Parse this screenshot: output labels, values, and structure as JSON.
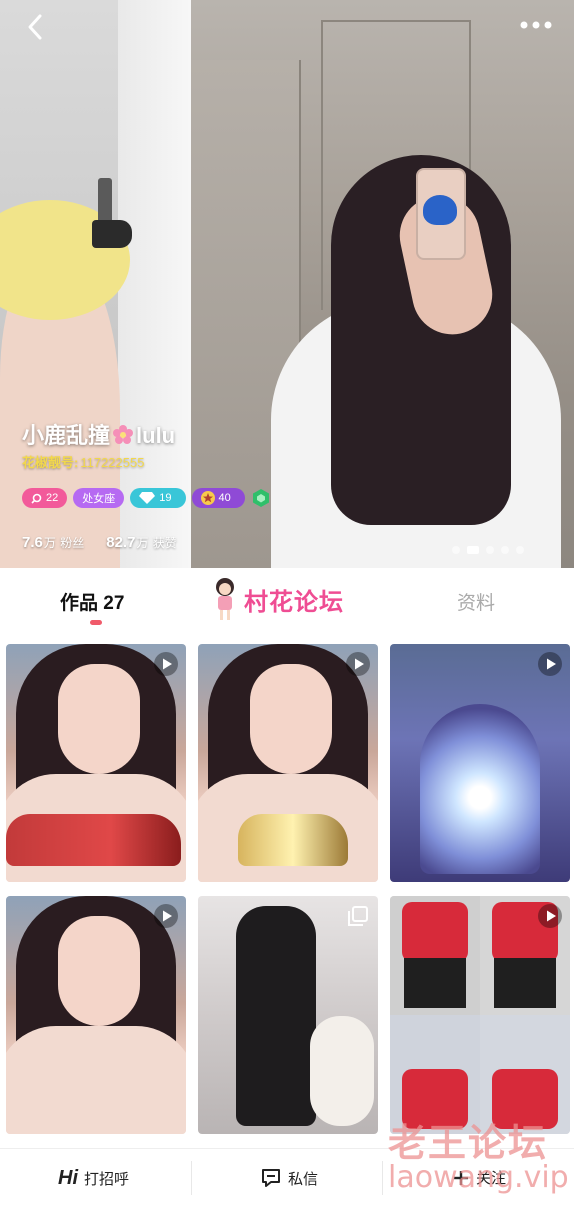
{
  "profile": {
    "name_prefix": "小鹿乱撞",
    "name_suffix": "lulu",
    "handle_label": "花椒靓号:",
    "handle_number": "117222555",
    "badges": {
      "level": "22",
      "tag": "处女座",
      "diamond": "19",
      "star": "40"
    },
    "fans_value": "7.6",
    "fans_unit": "万",
    "fans_label": "粉丝",
    "likes_value": "82.7",
    "likes_unit": "万",
    "likes_label": "获赞",
    "photo_index": 2,
    "photo_count": 5
  },
  "tabs": {
    "works_label": "作品",
    "works_count": "27",
    "info_label": "资料"
  },
  "overlay_watermarks": {
    "forum_center": "村花论坛",
    "corner_cn": "老王论坛",
    "corner_en": "laowang.vip"
  },
  "grid": {
    "tiles": [
      {
        "kind": "video",
        "theme": "face-red-car"
      },
      {
        "kind": "video",
        "theme": "face-gold-car"
      },
      {
        "kind": "video",
        "theme": "lamp"
      },
      {
        "kind": "video",
        "theme": "face-wave"
      },
      {
        "kind": "album",
        "theme": "black-dress-dog"
      },
      {
        "kind": "video",
        "theme": "red-top-collage"
      }
    ]
  },
  "bottom_bar": {
    "greet_icon_text": "Hi",
    "greet_label": "打招呼",
    "message_label": "私信",
    "follow_label": "关注"
  },
  "colors": {
    "accent_pink": "#f05a6a",
    "handle_gold": "#f2d84b",
    "badge_level": "#f25a9a",
    "badge_tag": "#b66af2",
    "badge_diamond": "#39c6d8",
    "badge_star": "#8f4ad6",
    "badge_green": "#2fbf6a"
  },
  "icons": [
    "back-icon",
    "more-icon",
    "flower-icon",
    "search-icon",
    "diamond-icon",
    "star-icon",
    "hexagon-icon",
    "play-icon",
    "multi-image-icon",
    "message-icon",
    "plus-icon"
  ]
}
